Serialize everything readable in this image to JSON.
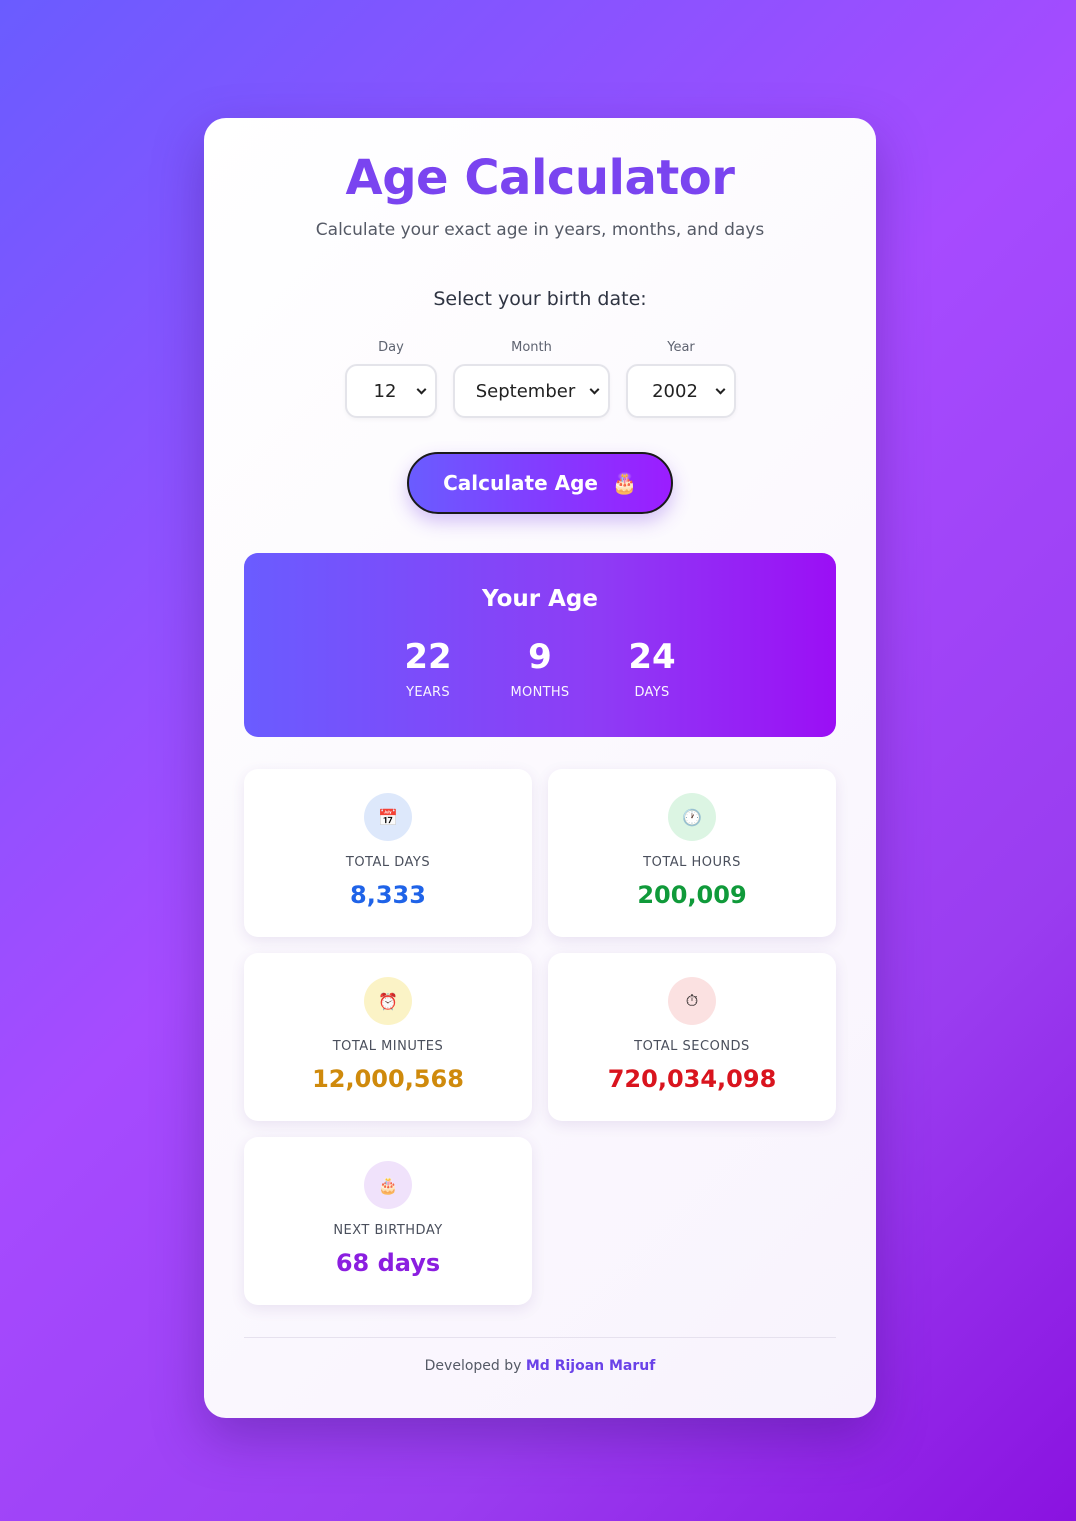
{
  "header": {
    "title": "Age Calculator",
    "subtitle": "Calculate your exact age in years, months, and days"
  },
  "form": {
    "heading": "Select your birth date:",
    "day_label": "Day",
    "day_value": "12",
    "month_label": "Month",
    "month_value": "September",
    "year_label": "Year",
    "year_value": "2002",
    "button_label": "Calculate Age",
    "button_icon": "🎂"
  },
  "age": {
    "title": "Your Age",
    "years": "22",
    "years_label": "YEARS",
    "months": "9",
    "months_label": "MONTHS",
    "days": "24",
    "days_label": "DAYS"
  },
  "stats": {
    "total_days": {
      "label": "TOTAL DAYS",
      "value": "8,333",
      "icon": "calendar-icon",
      "glyph": "📅",
      "color": "#1f63e8",
      "bg": "#dde8fb"
    },
    "total_hours": {
      "label": "TOTAL HOURS",
      "value": "200,009",
      "icon": "clock-icon",
      "glyph": "🕐",
      "color": "#109a3a",
      "bg": "#dcf5e3"
    },
    "total_minutes": {
      "label": "TOTAL MINUTES",
      "value": "12,000,568",
      "icon": "alarm-clock-icon",
      "glyph": "⏰",
      "color": "#cf8a0c",
      "bg": "#fbf3c6"
    },
    "total_seconds": {
      "label": "TOTAL SECONDS",
      "value": "720,034,098",
      "icon": "stopwatch-icon",
      "glyph": "⏱",
      "color": "#d9141e",
      "bg": "#fbe1e1"
    },
    "next_birthday": {
      "label": "NEXT BIRTHDAY",
      "value": "68 days",
      "icon": "birthday-cake-icon",
      "glyph": "🎂",
      "color": "#8b1ee0",
      "bg": "#f0e2fb"
    }
  },
  "footer": {
    "prefix": "Developed by",
    "author": "Md Rijoan Maruf"
  }
}
